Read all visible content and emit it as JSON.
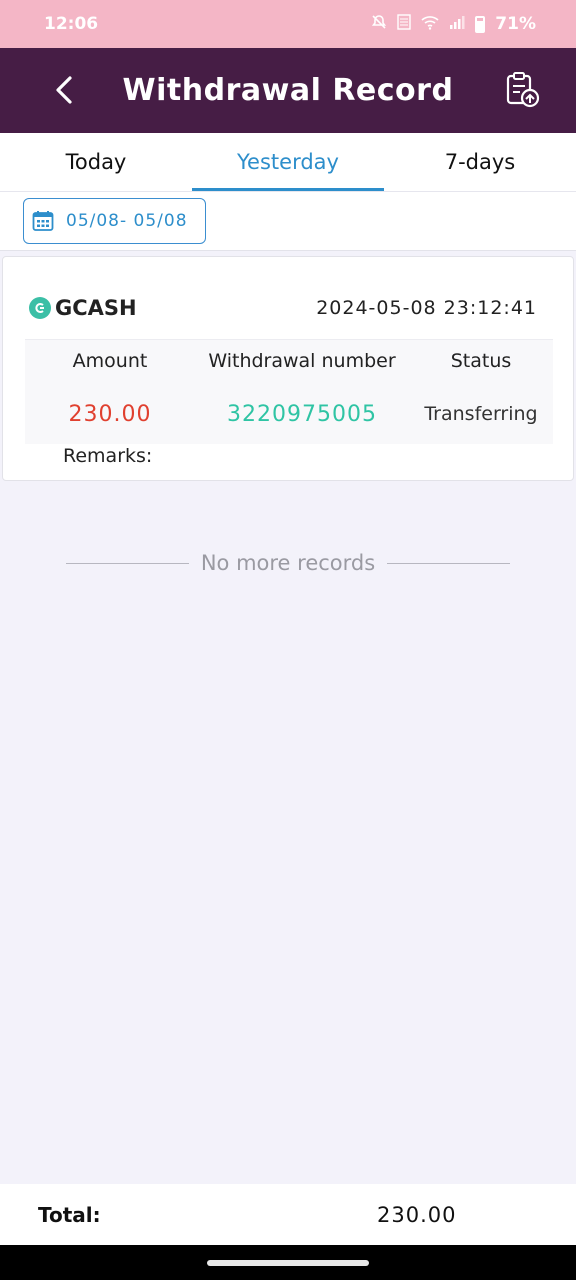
{
  "status_bar": {
    "time": "12:06",
    "battery": "71%"
  },
  "header": {
    "title": "Withdrawal Record"
  },
  "tabs": [
    {
      "label": "Today",
      "active": false
    },
    {
      "label": "Yesterday",
      "active": true
    },
    {
      "label": "7-days",
      "active": false
    }
  ],
  "date_filter": {
    "range": "05/08- 05/08"
  },
  "record": {
    "method": "GCASH",
    "timestamp": "2024-05-08 23:12:41",
    "columns": [
      "Amount",
      "Withdrawal number",
      "Status"
    ],
    "amount": "230.00",
    "withdrawal_number": "3220975005",
    "status": "Transferring",
    "remarks_label": "Remarks:"
  },
  "list_end": "No more records",
  "footer": {
    "total_label": "Total:",
    "total_value": "230.00"
  },
  "colors": {
    "status_bar": "#f4b6c6",
    "header": "#461d45",
    "accent": "#2d8ecb",
    "amount": "#e0402f",
    "withdrawal_number": "#2fc4a4"
  }
}
